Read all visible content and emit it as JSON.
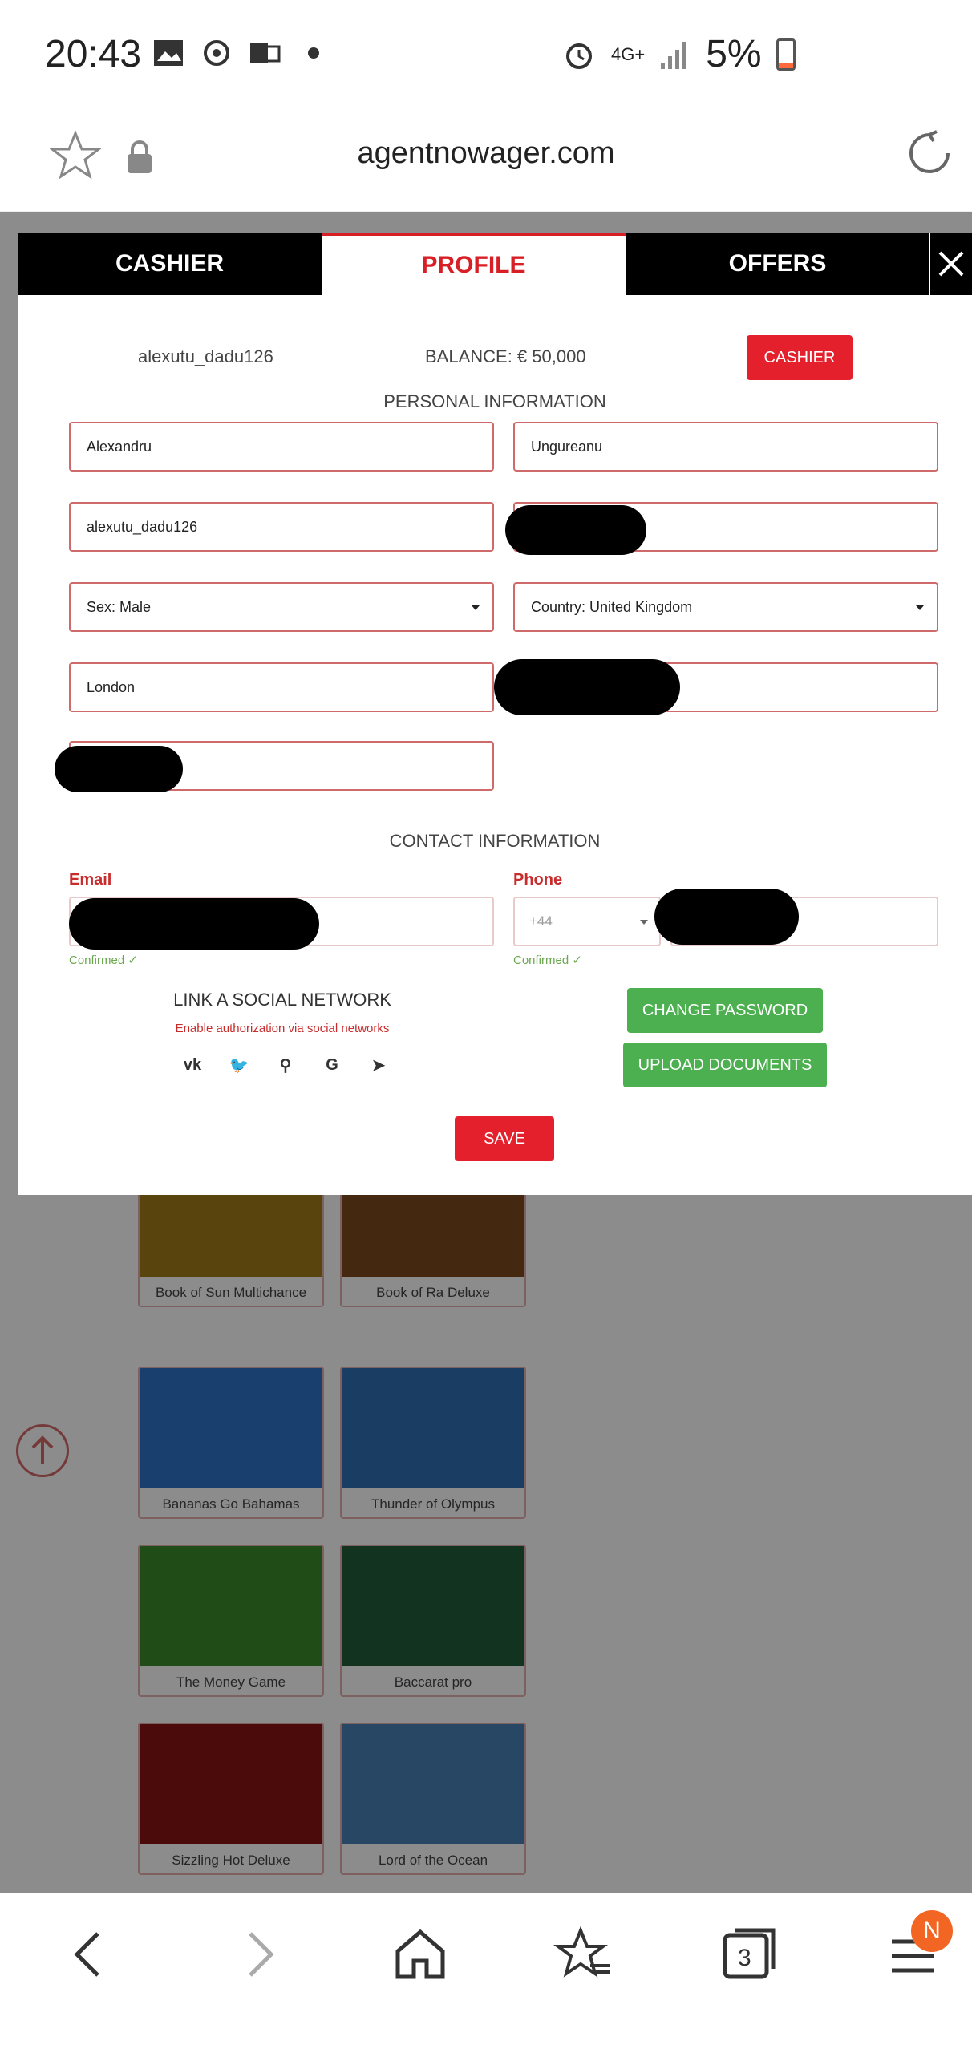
{
  "status_bar": {
    "time": "20:43",
    "network": "4G+",
    "battery": "5%"
  },
  "browser": {
    "url": "agentnowager.com",
    "tabs_count": "3",
    "menu_badge": "N"
  },
  "modal": {
    "tabs": [
      {
        "label": "CASHIER"
      },
      {
        "label": "PROFILE"
      },
      {
        "label": "OFFERS"
      }
    ],
    "username": "alexutu_dadu126",
    "balance": "BALANCE: € 50,000",
    "cashier_button": "CASHIER",
    "personal_title": "PERSONAL INFORMATION",
    "first_name": "Alexandru",
    "last_name": "Ungureanu",
    "login": "alexutu_dadu126",
    "sex": "Sex: Male",
    "country": "Country: United Kingdom",
    "city": "London",
    "contact_title": "CONTACT INFORMATION",
    "email_label": "Email",
    "phone_label": "Phone",
    "email_confirmed": "Confirmed",
    "phone_confirmed": "Confirmed",
    "phone_code": "+44",
    "social_title": "LINK A SOCIAL NETWORK",
    "social_subtitle": "Enable authorization via social networks",
    "social_icons": [
      "vk-icon",
      "twitter-icon",
      "odnoklassniki-icon",
      "google-icon",
      "telegram-icon"
    ],
    "change_password": "CHANGE PASSWORD",
    "upload_documents": "UPLOAD DOCUMENTS",
    "save": "SAVE"
  },
  "games": [
    {
      "name": "Book of Sun Multichance"
    },
    {
      "name": "Book of Ra Deluxe"
    },
    {
      "name": "Bananas Go Bahamas"
    },
    {
      "name": "Thunder of Olympus"
    },
    {
      "name": "The Money Game"
    },
    {
      "name": "Baccarat pro"
    },
    {
      "name": "Sizzling Hot Deluxe"
    },
    {
      "name": "Lord of the Ocean"
    }
  ],
  "colors": {
    "accent_red": "#e3202b",
    "green": "#4caf50",
    "dark": "#000000"
  }
}
